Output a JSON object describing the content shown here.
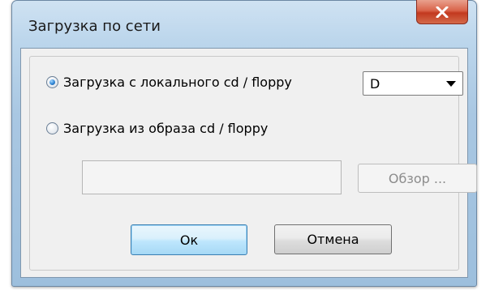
{
  "window": {
    "title": "Загрузка по сети"
  },
  "options": {
    "local": {
      "label": "Загрузка с локального cd / floppy",
      "checked": true
    },
    "image": {
      "label": "Загрузка из образа cd / floppy",
      "checked": false
    }
  },
  "drive_select": {
    "value": "D"
  },
  "image_path": {
    "value": ""
  },
  "buttons": {
    "browse": "Обзор ...",
    "ok": "Ок",
    "cancel": "Отмена"
  },
  "icons": {
    "close": "close-icon",
    "dropdown": "chevron-down-icon"
  },
  "colors": {
    "close_button": "#c2391f",
    "ok_border": "#3c7fb1",
    "radio_dot": "#2f86d6"
  }
}
